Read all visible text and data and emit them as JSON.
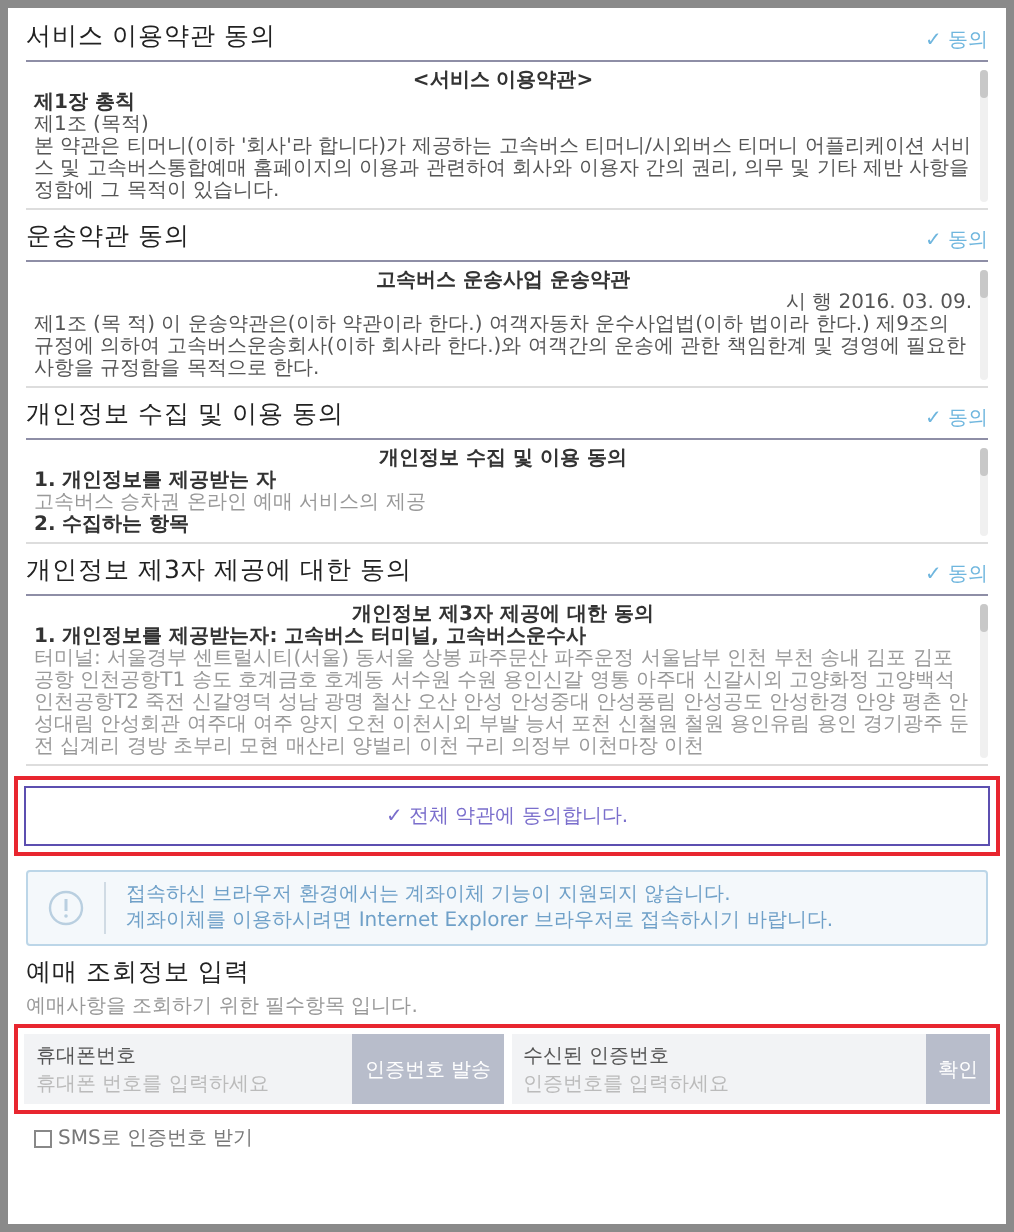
{
  "sections": [
    {
      "title": "서비스 이용약관 동의",
      "agree": "✓ 동의",
      "lines": [
        {
          "kind": "heading",
          "text": "<서비스 이용약관>"
        },
        {
          "kind": "subheading",
          "text": "제1장 총칙"
        },
        {
          "kind": "text",
          "text": "제1조 (목적)"
        },
        {
          "kind": "text",
          "text": "본 약관은 티머니(이하 '회사'라 합니다)가 제공하는 고속버스 티머니/시외버스 티머니 어플리케이션 서비스 및 고속버스통합예매 홈페이지의 이용과 관련하여 회사와 이용자 간의 권리, 의무 및 기타 제반 사항을 정함에 그 목적이 있습니다."
        }
      ]
    },
    {
      "title": "운송약관 동의",
      "agree": "✓ 동의",
      "lines": [
        {
          "kind": "heading",
          "text": "고속버스 운송사업 운송약관"
        },
        {
          "kind": "date",
          "text": "시 행 2016. 03. 09."
        },
        {
          "kind": "text",
          "text": "제1조 (목 적) 이 운송약관은(이하 약관이라 한다.) 여객자동차 운수사업법(이하 법이라 한다.) 제9조의 규정에 의하여 고속버스운송회사(이하 회사라 한다.)와 여객간의 운송에 관한 책임한계 및 경영에 필요한 사항을 규정함을 목적으로 한다."
        }
      ]
    },
    {
      "title": "개인정보 수집 및 이용 동의",
      "agree": "✓ 동의",
      "lines": [
        {
          "kind": "heading",
          "text": "개인정보 수집 및 이용 동의"
        },
        {
          "kind": "subheading",
          "text": "1. 개인정보를 제공받는 자"
        },
        {
          "kind": "muted",
          "text": "고속버스 승차권 온라인 예매 서비스의 제공"
        },
        {
          "kind": "subheading",
          "text": "2. 수집하는 항목"
        }
      ]
    },
    {
      "title": "개인정보 제3자 제공에 대한 동의",
      "agree": "✓ 동의",
      "lines": [
        {
          "kind": "heading",
          "text": "개인정보 제3자 제공에 대한 동의"
        },
        {
          "kind": "subheading",
          "text": "1. 개인정보를 제공받는자: 고속버스 터미널, 고속버스운수사"
        },
        {
          "kind": "muted",
          "text": "터미널: 서울경부 센트럴시티(서울) 동서울 상봉 파주문산 파주운정 서울남부 인천 부천 송내 김포 김포공항 인천공항T1 송도 호계금호 호계동 서수원 수원 용인신갈 영통 아주대 신갈시외 고양화정 고양백석 인천공항T2 죽전 신갈영덕 성남 광명 철산 오산 안성 안성중대 안성풍림 안성공도 안성한경 안양 평촌 안성대림 안성회관 여주대 여주 양지 오천 이천시외 부발 능서 포천 신철원 철원 용인유림 용인 경기광주 둔전 십계리 경방 초부리 모현 매산리 양벌리 이천 구리 의정부 이천마장 이천"
        }
      ]
    }
  ],
  "agree_all": {
    "label": "✓ 전체 약관에 동의합니다.",
    "highlighted": true
  },
  "notice": {
    "lines": [
      "접속하신 브라우저 환경에서는 계좌이체 기능이 지원되지 않습니다.",
      "계좌이체를 이용하시려면 Internet Explorer 브라우저로 접속하시기 바랍니다."
    ]
  },
  "lookup": {
    "title": "예매 조회정보 입력",
    "subtitle": "예매사항을 조회하기 위한 필수항목 입니다.",
    "highlighted": true,
    "fields": [
      {
        "label": "휴대폰번호",
        "placeholder": "휴대폰 번호를 입력하세요",
        "button": "인증번호 발송"
      },
      {
        "label": "수신된 인증번호",
        "placeholder": "인증번호를 입력하세요",
        "button": "확인"
      }
    ],
    "option": {
      "label": "SMS로 인증번호 받기",
      "checked": false
    }
  }
}
